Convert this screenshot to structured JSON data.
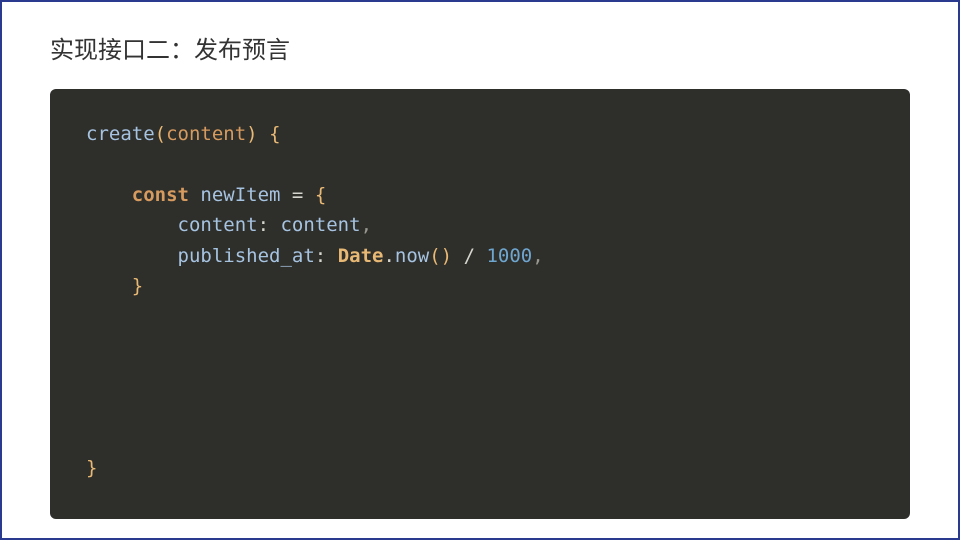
{
  "title": "实现接口二：发布预言",
  "code": {
    "line1": {
      "fn": "create",
      "open_paren": "(",
      "param": "content",
      "close_paren": ")",
      "space_brace": " {"
    },
    "line3": {
      "indent": "    ",
      "kw": "const",
      "var": " newItem ",
      "eq": "=",
      "brace": " {"
    },
    "line4": {
      "indent": "        ",
      "prop": "content",
      "colon": ": ",
      "val": "content",
      "comma": ","
    },
    "line5": {
      "indent": "        ",
      "prop": "published_at",
      "colon": ": ",
      "class": "Date",
      "dot": ".",
      "method": "now",
      "parens": "()",
      "div": " / ",
      "num": "1000",
      "comma": ","
    },
    "line6": {
      "indent": "    ",
      "brace": "}"
    },
    "line_end": {
      "brace": "}"
    }
  }
}
